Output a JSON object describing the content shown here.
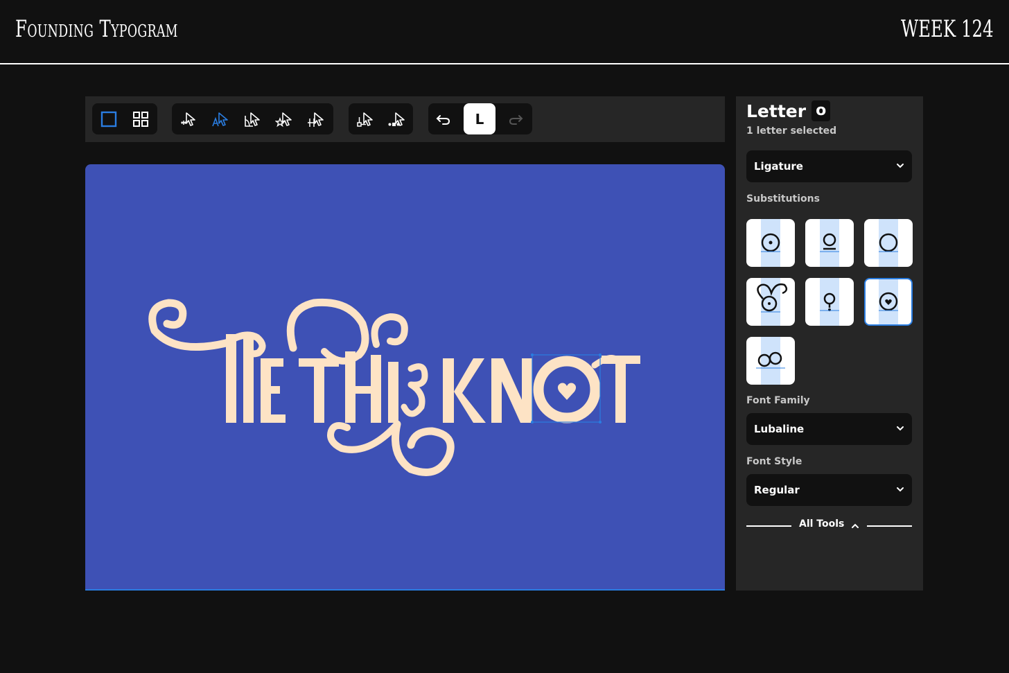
{
  "header": {
    "brand": "Founding Typogram",
    "week": "WEEK 124"
  },
  "toolbar": {
    "undo_label": "Undo",
    "current_tool_letter": "L",
    "redo_label": "Redo"
  },
  "canvas": {
    "text": "TIE THE KNOT",
    "background_color": "#3e51b5",
    "text_color": "#fde3c5",
    "selection_color": "#2a7de1"
  },
  "panel": {
    "title": "Letter",
    "letter": "o",
    "subtitle": "1 letter selected",
    "ligature_select": "Ligature",
    "substitutions_label": "Substitutions",
    "font_family_label": "Font Family",
    "font_family_value": "Lubaline",
    "font_style_label": "Font Style",
    "font_style_value": "Regular",
    "all_tools_label": "All Tools"
  },
  "icons": {
    "frame": "square-frame-icon",
    "grid": "grid-icon",
    "move": "move-letter-icon",
    "letter": "letter-select-icon",
    "rotate": "rotate-icon",
    "star": "star-icon",
    "spacing": "spacing-icon",
    "baseline": "baseline-icon",
    "node": "node-icon",
    "undo": "undo-icon",
    "redo": "redo-icon",
    "chevron": "chevron-down-icon",
    "chevron_up": "chevron-up-icon"
  }
}
